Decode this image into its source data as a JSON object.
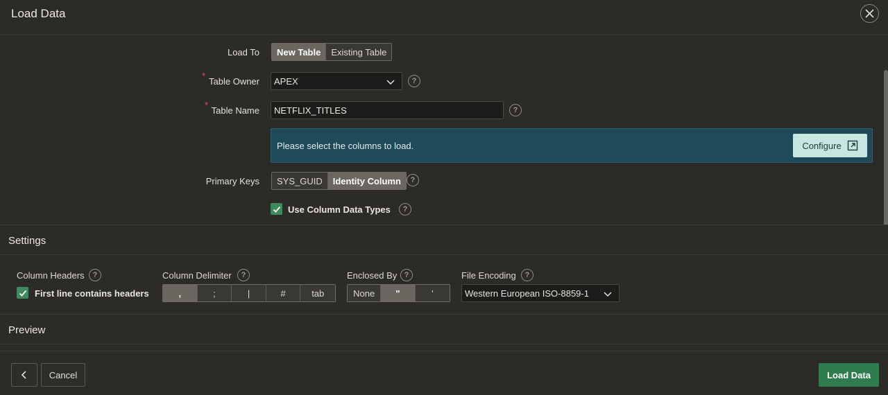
{
  "dialog": {
    "title": "Load Data",
    "close_icon": "close-icon"
  },
  "form": {
    "load_to": {
      "label": "Load To",
      "options": [
        "New Table",
        "Existing Table"
      ],
      "selected": "New Table"
    },
    "table_owner": {
      "label": "Table Owner",
      "required_marker": "*",
      "value": "APEX"
    },
    "table_name": {
      "label": "Table Name",
      "required_marker": "*",
      "value": "NETFLIX_TITLES"
    },
    "banner": {
      "message": "Please select the columns to load.",
      "button_label": "Configure",
      "button_icon": "external-open-icon"
    },
    "primary_keys": {
      "label": "Primary Keys",
      "options": [
        "SYS_GUID",
        "Identity Column"
      ],
      "selected": "Identity Column"
    },
    "use_column_data_types": {
      "label": "Use Column Data Types",
      "checked": true
    }
  },
  "settings": {
    "title": "Settings",
    "column_headers": {
      "label": "Column Headers",
      "checkbox_label": "First line contains headers",
      "checked": true
    },
    "column_delimiter": {
      "label": "Column Delimiter",
      "options": [
        ",",
        ";",
        "|",
        "#",
        "tab"
      ],
      "selected": ","
    },
    "enclosed_by": {
      "label": "Enclosed By",
      "options": [
        "None",
        "\"",
        "'"
      ],
      "selected": "\""
    },
    "file_encoding": {
      "label": "File Encoding",
      "value": "Western European ISO-8859-1"
    }
  },
  "preview": {
    "title": "Preview"
  },
  "footer": {
    "back_icon": "chevron-left-icon",
    "cancel_label": "Cancel",
    "load_label": "Load Data"
  },
  "help_glyph": "?",
  "colors": {
    "background": "#2d2b28",
    "banner": "#1f4a58",
    "configure_button": "#c6e6df",
    "primary_button": "#2f7d4f",
    "checkbox": "#3e8a5c",
    "required": "#e0524f"
  }
}
